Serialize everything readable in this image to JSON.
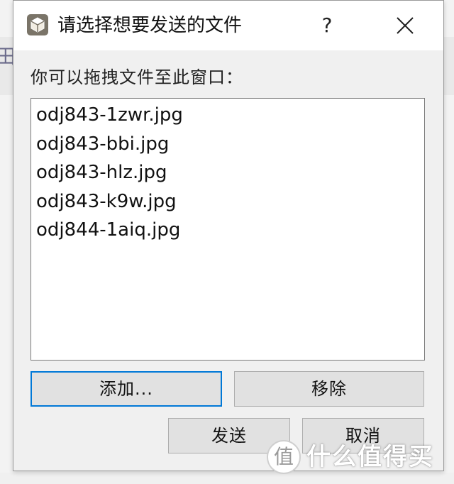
{
  "dialog": {
    "title": "请选择想要发送的文件",
    "help_label": "?",
    "prompt": "你可以拖拽文件至此窗口：",
    "files": [
      "odj843-1zwr.jpg",
      "odj843-bbi.jpg",
      "odj843-hlz.jpg",
      "odj843-k9w.jpg",
      "odj844-1aiq.jpg"
    ],
    "buttons": {
      "add": "添加...",
      "remove": "移除",
      "send": "发送",
      "cancel": "取消"
    }
  },
  "background": {
    "glyph": "田"
  },
  "watermark": {
    "badge": "值",
    "text": "什么值得买"
  },
  "colors": {
    "focus_border": "#0078d7",
    "dialog_bg": "#f0f0f0",
    "titlebar_bg": "#ffffff"
  },
  "icons": {
    "app": "package-box-icon",
    "close": "close-icon"
  }
}
